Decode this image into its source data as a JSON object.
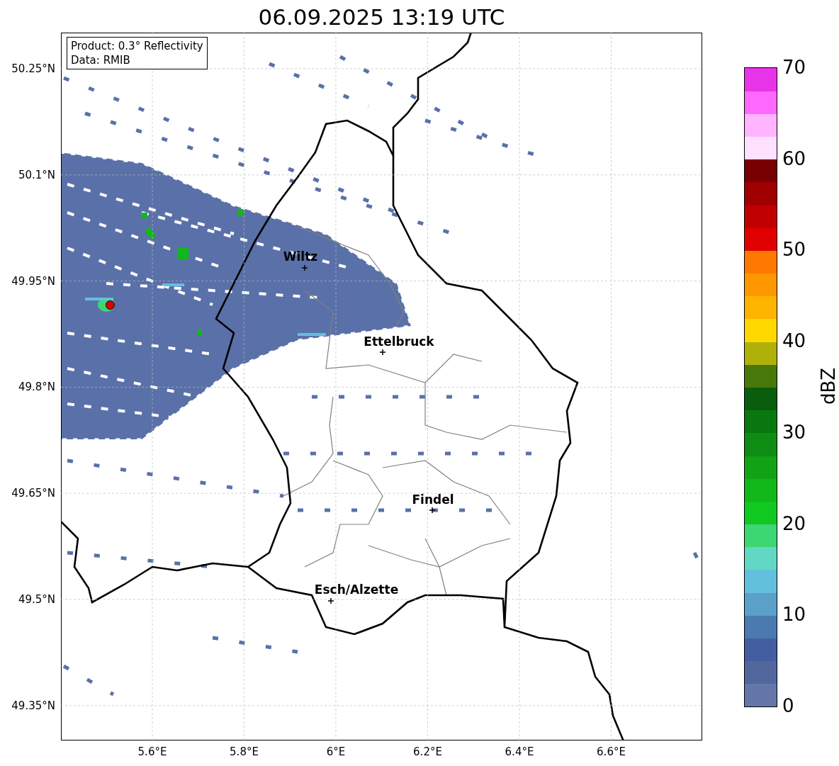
{
  "title": "06.09.2025 13:19 UTC",
  "info_box": [
    "Product: 0.3° Reflectivity",
    "Data: RMIB"
  ],
  "latitude_ticks": [
    "50.25°N",
    "50.1°N",
    "49.95°N",
    "49.8°N",
    "49.65°N",
    "49.5°N",
    "49.35°N"
  ],
  "longitude_ticks": [
    "5.6°E",
    "5.8°E",
    "6°E",
    "6.2°E",
    "6.4°E",
    "6.6°E"
  ],
  "cities": [
    {
      "name": "Wiltz"
    },
    {
      "name": "Ettelbruck"
    },
    {
      "name": "Findel"
    },
    {
      "name": "Esch/Alzette"
    }
  ],
  "colorbar": {
    "label": "dBZ",
    "ticks": [
      "70",
      "60",
      "50",
      "40",
      "30",
      "20",
      "10",
      "0"
    ],
    "segments": [
      {
        "color": "#6577a8"
      },
      {
        "color": "#52679e"
      },
      {
        "color": "#435ea0"
      },
      {
        "color": "#4a7ab0"
      },
      {
        "color": "#5aa0c8"
      },
      {
        "color": "#62c0dc"
      },
      {
        "color": "#60d8c4"
      },
      {
        "color": "#3cd672"
      },
      {
        "color": "#10c820"
      },
      {
        "color": "#10b81a"
      },
      {
        "color": "#10a414"
      },
      {
        "color": "#0e8c14"
      },
      {
        "color": "#0a7810"
      },
      {
        "color": "#085e0c"
      },
      {
        "color": "#48780a"
      },
      {
        "color": "#b0b00a"
      },
      {
        "color": "#ffd800"
      },
      {
        "color": "#ffb400"
      },
      {
        "color": "#ff9800"
      },
      {
        "color": "#ff7800"
      },
      {
        "color": "#e00000"
      },
      {
        "color": "#c00000"
      },
      {
        "color": "#a00000"
      },
      {
        "color": "#780000"
      },
      {
        "color": "#ffe0ff"
      },
      {
        "color": "#ffb4ff"
      },
      {
        "color": "#ff68ff"
      },
      {
        "color": "#e834e8"
      }
    ]
  }
}
